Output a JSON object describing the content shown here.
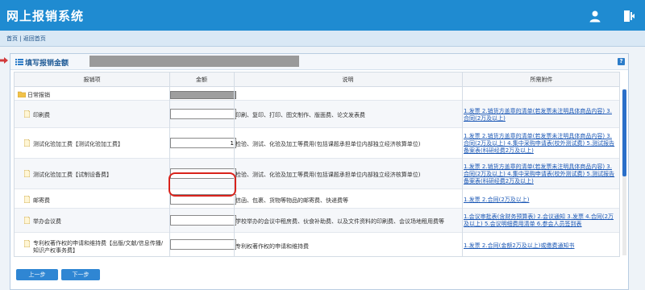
{
  "app": {
    "title": "网上报销系统"
  },
  "nav": {
    "breadcrumb": "首页 | 返回首页"
  },
  "panel": {
    "title": "填写报销金额"
  },
  "table": {
    "headers": [
      "报销项",
      "金额",
      "说明",
      "所需附件"
    ]
  },
  "rows": [
    {
      "name": "日常报销",
      "amount": "",
      "desc": "",
      "attachments": ""
    },
    {
      "name": "印刷费",
      "amount": "",
      "desc": "印刷、复印、打印、图文制作、版面费、论文发表费",
      "attachments": "1.发票 2.销货方盖章的清单(若发票未注明具体商品内容) 3.合同(2万及以上)"
    },
    {
      "name": "测试化验加工费【测试化验加工费】",
      "amount": "1",
      "desc": "检验、测试、化验及加工等费用(包括课题承担单位内部独立经济核算单位)",
      "attachments": "1.发票 2.销货方盖章的清单(若发票未注明具体商品内容) 3.合同(2万及以上) 4.集中采购申请表(校外测试费) 5.测试报告备案表(科研经费2万及以上)"
    },
    {
      "name": "测试化验加工费【试制设备费】",
      "amount": "",
      "desc": "检验、测试、化验及加工等费用(包括课题承担单位内部独立经济核算单位)",
      "attachments": "1.发票 2.销货方盖章的清单(若发票未注明具体商品内容) 3.合同(2万及以上) 4.集中采购申请表(校外测试费) 5.测试报告备案表(科研经费2万及以上)"
    },
    {
      "name": "邮寄费",
      "amount": "",
      "desc": "信函、包裹、货物等物品的邮寄费、快递费等",
      "attachments": "1.发票 2.合同(2万及以上)"
    },
    {
      "name": "举办会议费",
      "amount": "",
      "desc": "学校举办的会议中租房费、伙食补助费、以及文件资料的印刷费、会议场地租用费等",
      "attachments": "1.会议审批表(含财务预算表) 2.会议通知 3.发票 4.合同(2万及以上) 5.会议明细费用清单 6.参会人员签到表"
    },
    {
      "name": "专利权著作权的申请和维持费【出版/文献/信息传播/知识产权事务费】",
      "amount": "",
      "desc": "专利权著作权的申请和维持费",
      "attachments": "1.发票 2.合同(金额2万及以上)或缴费通知书"
    }
  ],
  "buttons": {
    "prev": "上一步",
    "next": "下一步"
  }
}
